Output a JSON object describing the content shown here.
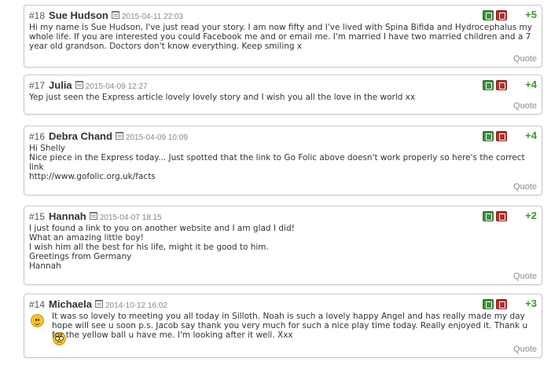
{
  "quote_label": "Quote",
  "comments": [
    {
      "num": "#18",
      "author": "Sue Hudson",
      "date": "2015-04-11 22:03",
      "score": "+5",
      "lines": [
        "Hi my name is Sue Hudson, I've just read your story. I am now fifty and I've lived with Spina Bifida and Hydrocephalus my whole life. If you are interested you could Facebook me and or email me. I'm married I have two married children and a 7 year old grandson. Doctors don't know everything. Keep smiling x"
      ]
    },
    {
      "num": "#17",
      "author": "Julia",
      "date": "2015-04-09 12:27",
      "score": "+4",
      "lines": [
        "Yep just seen the Express article lovely lovely story and I wish you all the love in the world xx"
      ]
    },
    {
      "num": "#16",
      "author": "Debra Chand",
      "date": "2015-04-09 10:09",
      "score": "+4",
      "lines": [
        "Hi Shelly",
        "Nice piece in the Express today... Just spotted that the link to Go Folic above doesn't work properly so here's the correct link",
        "http://www.gofolic.org.uk/facts"
      ]
    },
    {
      "num": "#15",
      "author": "Hannah",
      "date": "2015-04-07 18:15",
      "score": "+2",
      "lines": [
        "I just found a link to you on another website and I am glad I did!",
        "What an amazing little boy!",
        "I wish him all the best for his life, might it be good to him.",
        "Greetings from Germany",
        "Hannah"
      ]
    },
    {
      "num": "#14",
      "author": "Michaela",
      "date": "2014-10-12 16:02",
      "score": "+3",
      "lines": [
        "It was so lovely to meeting you all today in Silloth. Noah is such a lovely happy Angel and has really made my day hope will see u soon p.s. Jacob say thank you very much for such a nice play time today. Really enjoyed it. Thank u for the yellow ball u have me. I'm looking after it well. Xxx"
      ],
      "smileys": [
        "smile-icon",
        "rolling-eyes-icon"
      ]
    }
  ]
}
